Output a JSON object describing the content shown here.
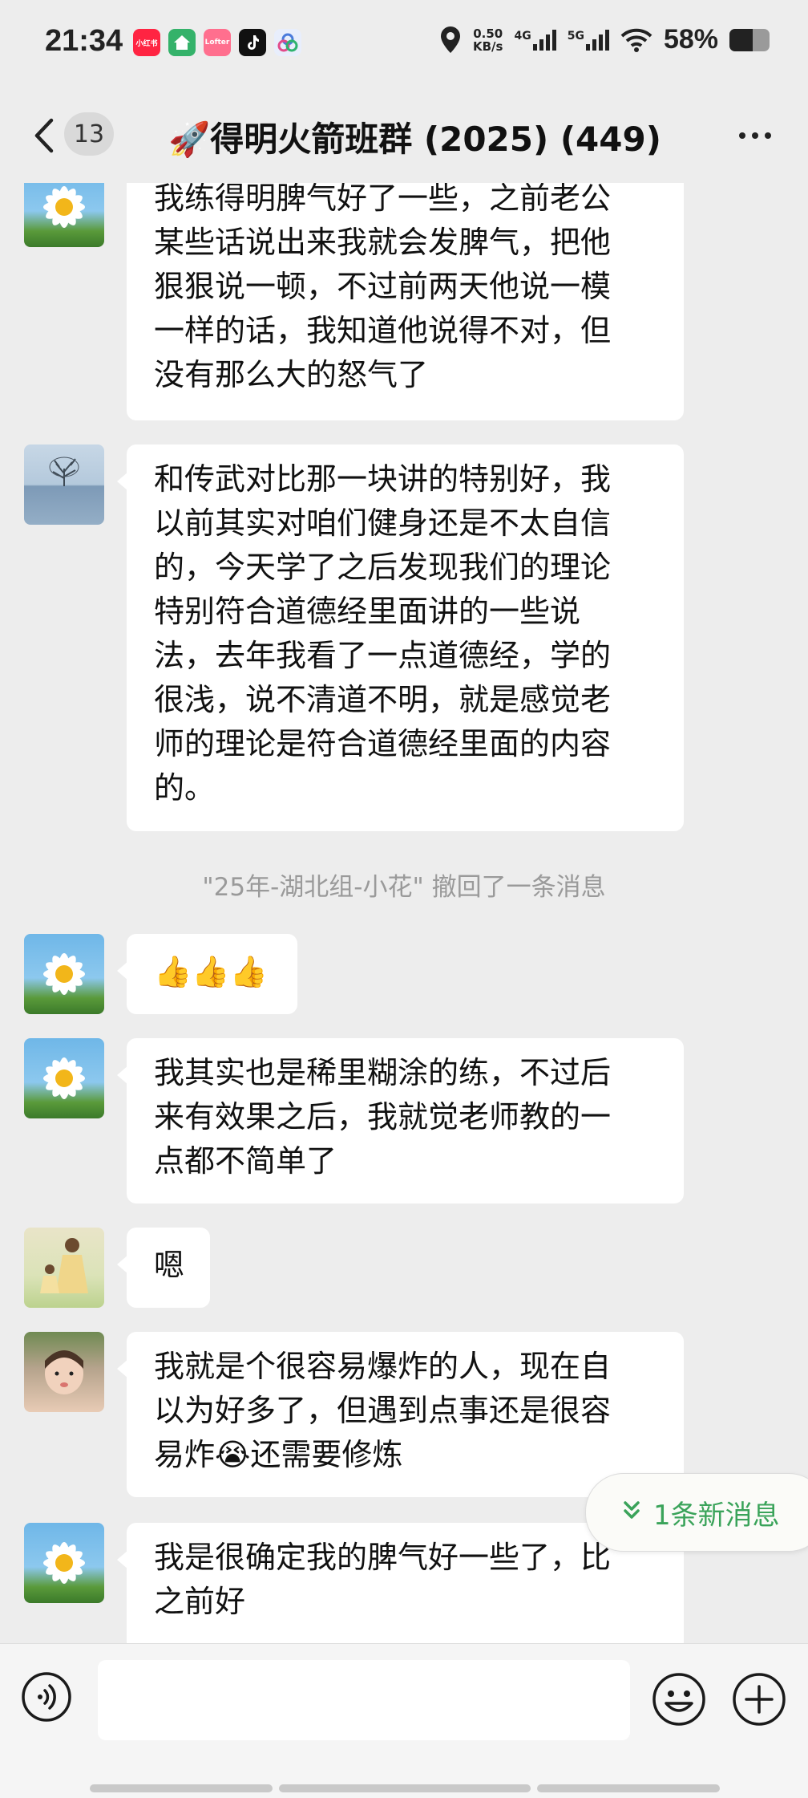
{
  "status_bar": {
    "time": "21:34",
    "apps": [
      {
        "name": "xiaohongshu-app-icon",
        "label": "小红书",
        "color": "#ff2442"
      },
      {
        "name": "home-app-icon",
        "label": "",
        "color": "#34b26a"
      },
      {
        "name": "lofter-app-icon",
        "label": "Lofter",
        "color": "#ff6f8e"
      },
      {
        "name": "tiktok-app-icon",
        "label": "",
        "color": "#111111"
      },
      {
        "name": "game-center-app-icon",
        "label": "",
        "color": "#e8eefc"
      }
    ],
    "net_speed_value": "0.50",
    "net_speed_unit": "KB/s",
    "signal1_label": "4G",
    "signal2_label": "5G",
    "battery_percent": "58%",
    "battery_level": 0.58
  },
  "header": {
    "unread_count": "13",
    "title": "🚀得明火箭班群 (2025) (449)"
  },
  "messages": [
    {
      "avatar": "daisy",
      "lines": [
        "我练得明脾气好了一些，之前老公",
        "某些话说出来我就会发脾气，把他",
        "狠狠说一顿，不过前两天他说一模",
        "一样的话，我知道他说得不对，但",
        "没有那么大的怒气了"
      ]
    },
    {
      "avatar": "tree",
      "lines": [
        "和传武对比那一块讲的特别好，我",
        "以前其实对咱们健身还是不太自信",
        "的，今天学了之后发现我们的理论",
        "特别符合道德经里面讲的一些说",
        "法，去年我看了一点道德经，学的",
        "很浅，说不清道不明，就是感觉老",
        "师的理论是符合道德经里面的内容",
        "的。"
      ]
    },
    {
      "avatar": "daisy",
      "lines": [
        "👍👍👍"
      ]
    },
    {
      "avatar": "daisy",
      "lines": [
        "我其实也是稀里糊涂的练，不过后",
        "来有效果之后，我就觉老师教的一",
        "点都不简单了"
      ]
    },
    {
      "avatar": "girls",
      "lines": [
        "嗯"
      ]
    },
    {
      "avatar": "kid",
      "lines": [
        "我就是个很容易爆炸的人，现在自",
        "以为好多了，但遇到点事还是很容",
        "易炸😭还需要修炼"
      ]
    },
    {
      "avatar": "daisy",
      "lines": [
        "我是很确定我的脾气好一些了，比",
        "之前好"
      ]
    }
  ],
  "system_note": "\"25年-湖北组-小花\" 撤回了一条消息",
  "new_messages_pill": "1条新消息",
  "input": {
    "value": "",
    "placeholder": ""
  }
}
